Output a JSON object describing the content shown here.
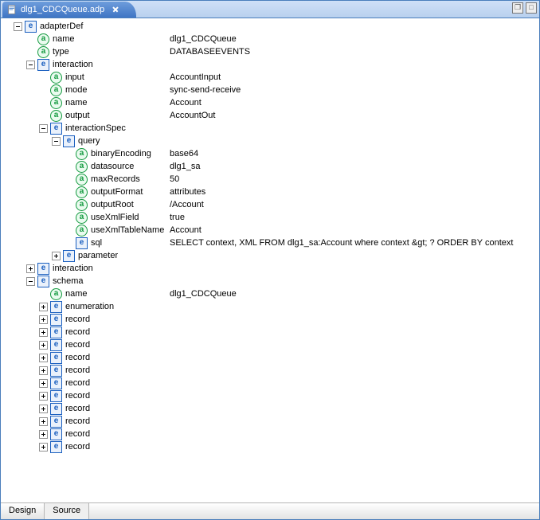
{
  "tab": {
    "title": "dlg1_CDCQueue.adp"
  },
  "window": {
    "restore_glyph": "❐",
    "max_glyph": "□"
  },
  "tree": {
    "adapterDef": "adapterDef",
    "name_k": "name",
    "name_v": "dlg1_CDCQueue",
    "type_k": "type",
    "type_v": "DATABASEEVENTS",
    "interaction": "interaction",
    "input_k": "input",
    "input_v": "AccountInput",
    "mode_k": "mode",
    "mode_v": "sync-send-receive",
    "name2_k": "name",
    "name2_v": "Account",
    "output_k": "output",
    "output_v": "AccountOut",
    "interactionSpec": "interactionSpec",
    "query": "query",
    "binaryEncoding_k": "binaryEncoding",
    "binaryEncoding_v": "base64",
    "datasource_k": "datasource",
    "datasource_v": "dlg1_sa",
    "maxRecords_k": "maxRecords",
    "maxRecords_v": "50",
    "outputFormat_k": "outputFormat",
    "outputFormat_v": "attributes",
    "outputRoot_k": "outputRoot",
    "outputRoot_v": "/Account",
    "useXmlField_k": "useXmlField",
    "useXmlField_v": "true",
    "useXmlTableName_k": "useXmlTableName",
    "useXmlTableName_v": "Account",
    "sql_k": "sql",
    "sql_v": "SELECT context, XML FROM dlg1_sa:Account where context &gt; ? ORDER BY context",
    "parameter": "parameter",
    "interaction2": "interaction",
    "schema": "schema",
    "sname_k": "name",
    "sname_v": "dlg1_CDCQueue",
    "enumeration": "enumeration",
    "record": "record"
  },
  "bottom": {
    "design": "Design",
    "source": "Source"
  }
}
